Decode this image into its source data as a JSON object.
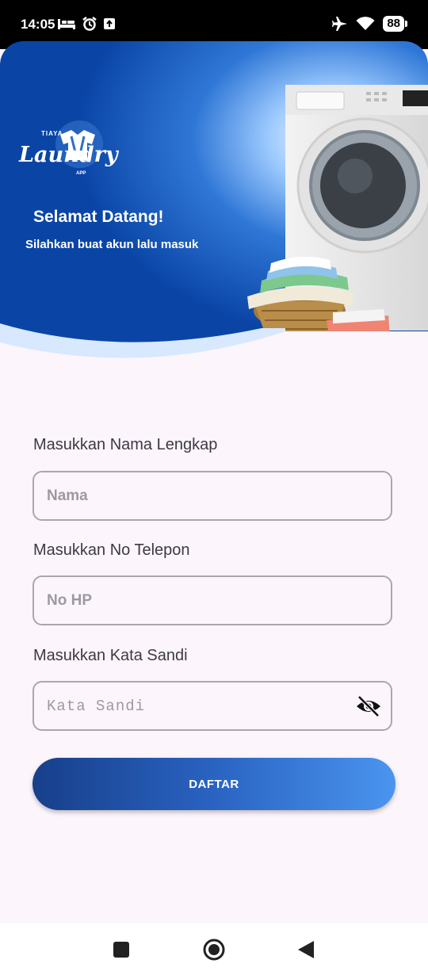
{
  "status_bar": {
    "time": "14:05",
    "battery": "88",
    "left_icons": [
      "bed-icon",
      "alarm-icon",
      "upload-icon"
    ],
    "right_icons": [
      "airplane-icon",
      "wifi-icon",
      "battery-icon"
    ]
  },
  "header": {
    "brand_top": "TIAYA",
    "brand_main": "Laundry",
    "brand_sub": "APP",
    "welcome_title": "Selamat Datang!",
    "welcome_subtitle": "Silahkan buat akun lalu masuk"
  },
  "form": {
    "name_label": "Masukkan Nama Lengkap",
    "name_placeholder": "Nama",
    "phone_label": "Masukkan No Telepon",
    "phone_placeholder": "No HP",
    "password_label": "Masukkan Kata Sandi",
    "password_placeholder": "Kata Sandi",
    "submit_label": "DAFTAR"
  },
  "colors": {
    "hero_blue": "#0c47a8",
    "accent_light": "#d7e8ff",
    "background": "#fcf5fc",
    "button_start": "#173f8a",
    "button_end": "#4a95ef"
  },
  "nav": {
    "icons": [
      "recents-square-icon",
      "home-circle-icon",
      "back-triangle-icon"
    ]
  }
}
